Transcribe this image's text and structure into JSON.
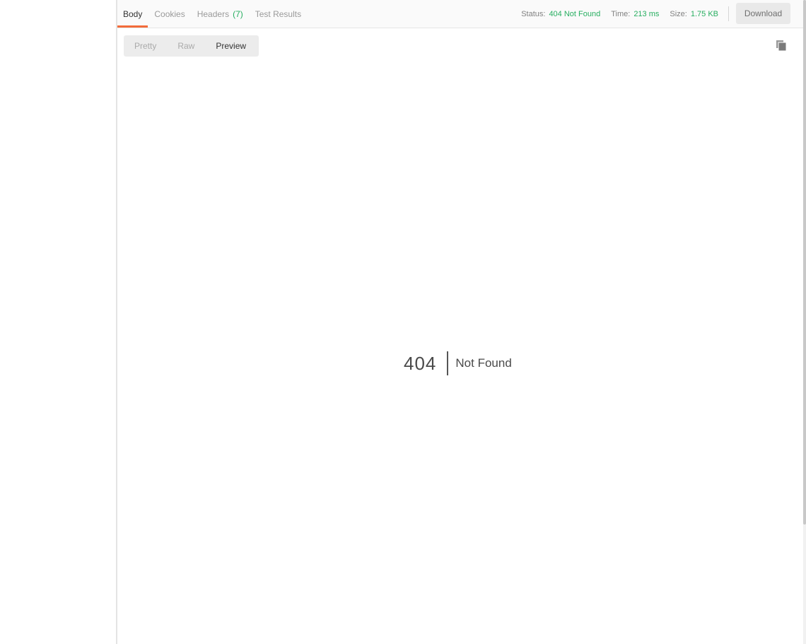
{
  "tabs": [
    {
      "label": "Body"
    },
    {
      "label": "Cookies"
    },
    {
      "label": "Headers",
      "count": "(7)"
    },
    {
      "label": "Test Results"
    }
  ],
  "response_meta": {
    "status_label": "Status:",
    "status_value": "404 Not Found",
    "time_label": "Time:",
    "time_value": "213 ms",
    "size_label": "Size:",
    "size_value": "1.75 KB"
  },
  "download_label": "Download",
  "view_modes": [
    {
      "label": "Pretty"
    },
    {
      "label": "Raw"
    },
    {
      "label": "Preview"
    }
  ],
  "preview": {
    "code": "404",
    "message": "Not Found"
  },
  "colors": {
    "accent": "#f26b3a",
    "success": "#27ae60"
  },
  "icons": {
    "copy": "copy-icon"
  }
}
